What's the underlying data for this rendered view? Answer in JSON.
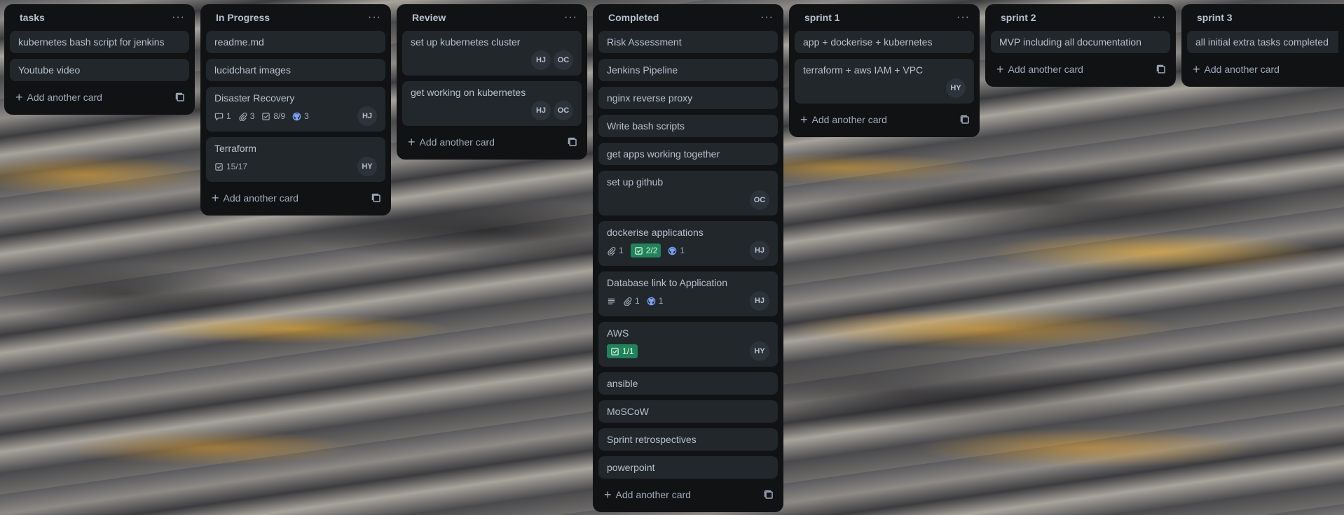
{
  "add_label": "Add another card",
  "menu_glyph": "···",
  "lists": {
    "tasks": {
      "title": "tasks",
      "cards": [
        "kubernetes bash script for jenkins",
        "Youtube video"
      ]
    },
    "in_progress": {
      "title": "In Progress",
      "cards": {
        "c1": "readme.md",
        "c2": "lucidchart images",
        "c3": {
          "title": "Disaster Recovery",
          "comments": "1",
          "attachments": "3",
          "checklist": "8/9",
          "github": "3",
          "avatar": "HJ"
        },
        "c4": {
          "title": "Terraform",
          "checklist": "15/17",
          "avatar": "HY"
        }
      }
    },
    "review": {
      "title": "Review",
      "cards": {
        "c1": {
          "title": "set up kubernetes cluster",
          "avatars": [
            "HJ",
            "OC"
          ]
        },
        "c2": {
          "title": "get working on kubernetes",
          "avatars": [
            "HJ",
            "OC"
          ]
        }
      }
    },
    "completed": {
      "title": "Completed",
      "cards": {
        "c1": "Risk Assessment",
        "c2": "Jenkins Pipeline",
        "c3": "nginx reverse proxy",
        "c4": "Write bash scripts",
        "c5": "get apps working together",
        "c6": {
          "title": "set up github",
          "avatar": "OC"
        },
        "c7": {
          "title": "dockerise applications",
          "attachments": "1",
          "checklist": "2/2",
          "github": "1",
          "avatar": "HJ"
        },
        "c8": {
          "title": "Database link to Application",
          "attachments": "1",
          "github": "1",
          "avatar": "HJ"
        },
        "c9": {
          "title": "AWS",
          "checklist": "1/1",
          "avatar": "HY"
        },
        "c10": "ansible",
        "c11": "MoSCoW",
        "c12": "Sprint retrospectives",
        "c13": "powerpoint"
      }
    },
    "sprint1": {
      "title": "sprint 1",
      "cards": {
        "c1": "app + dockerise + kubernetes",
        "c2": {
          "title": "terraform + aws IAM + VPC",
          "avatar": "HY"
        }
      }
    },
    "sprint2": {
      "title": "sprint 2",
      "cards": [
        "MVP including all documentation"
      ]
    },
    "sprint3": {
      "title": "sprint 3",
      "cards": [
        "all initial extra tasks completed"
      ]
    }
  }
}
